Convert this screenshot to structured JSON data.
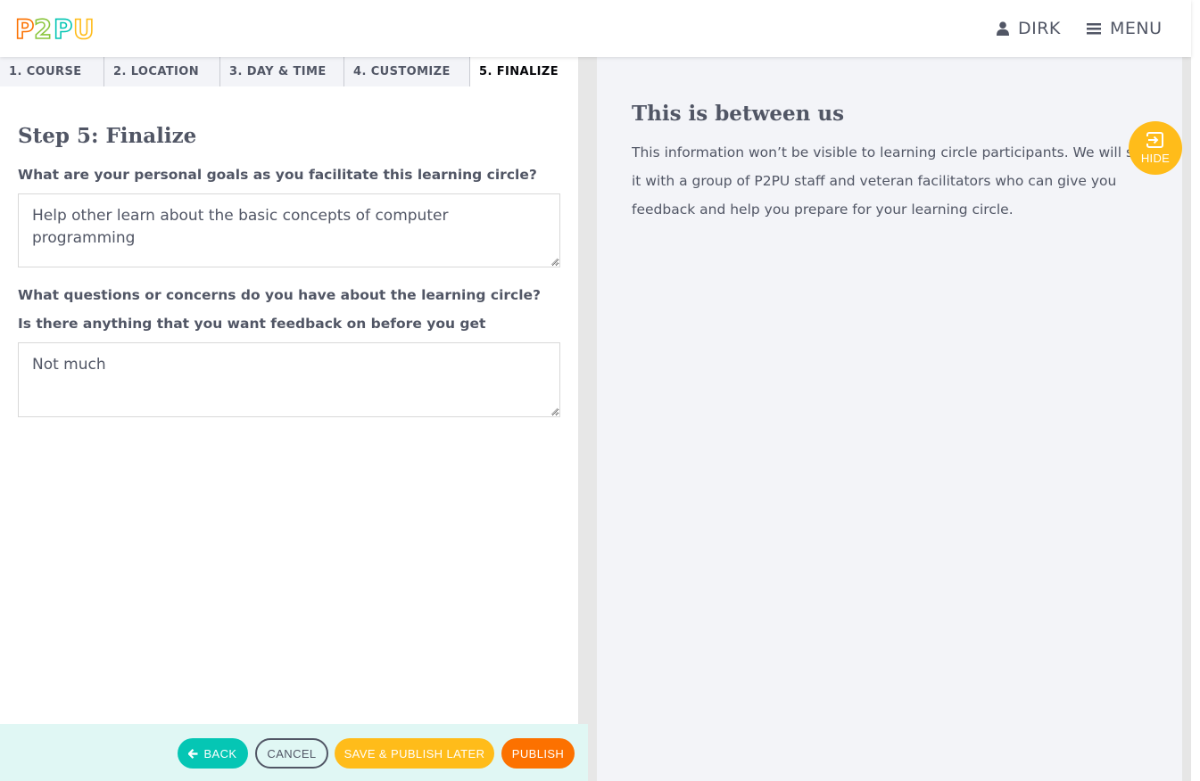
{
  "header": {
    "logo_text": "P2PU",
    "user_label": "DIRK",
    "menu_label": "MENU"
  },
  "tabs": [
    {
      "label": "1. COURSE",
      "active": false
    },
    {
      "label": "2. LOCATION",
      "active": false
    },
    {
      "label": "3. DAY & TIME",
      "active": false
    },
    {
      "label": "4. CUSTOMIZE",
      "active": false
    },
    {
      "label": "5. FINALIZE",
      "active": true
    }
  ],
  "form": {
    "title": "Step 5: Finalize",
    "goals_question": "What are your personal goals as you facilitate this learning circle?",
    "goals_value": "Help other learn about the basic concepts of computer programming",
    "concerns_question": "What questions or concerns do you have about the learning circle? Is there anything that you want feedback on before you get started?",
    "concerns_value": "Not much"
  },
  "actions": {
    "back": "BACK",
    "cancel": "CANCEL",
    "save_later": "SAVE & PUBLISH LATER",
    "publish": "PUBLISH"
  },
  "help": {
    "title": "This is between us",
    "body": "This information won’t be visible to learning circle participants. We will share it with a group of P2PU staff and veteran facilitators who can give you feedback and help you prepare for your learning circle.",
    "hide_label": "HIDE"
  },
  "colors": {
    "text": "#515665",
    "teal": "#05c6b4",
    "yellow": "#ffbc1a",
    "orange": "#fc7100",
    "action_bar_bg": "#e0f7f4",
    "help_bg": "#f3f4f8"
  }
}
